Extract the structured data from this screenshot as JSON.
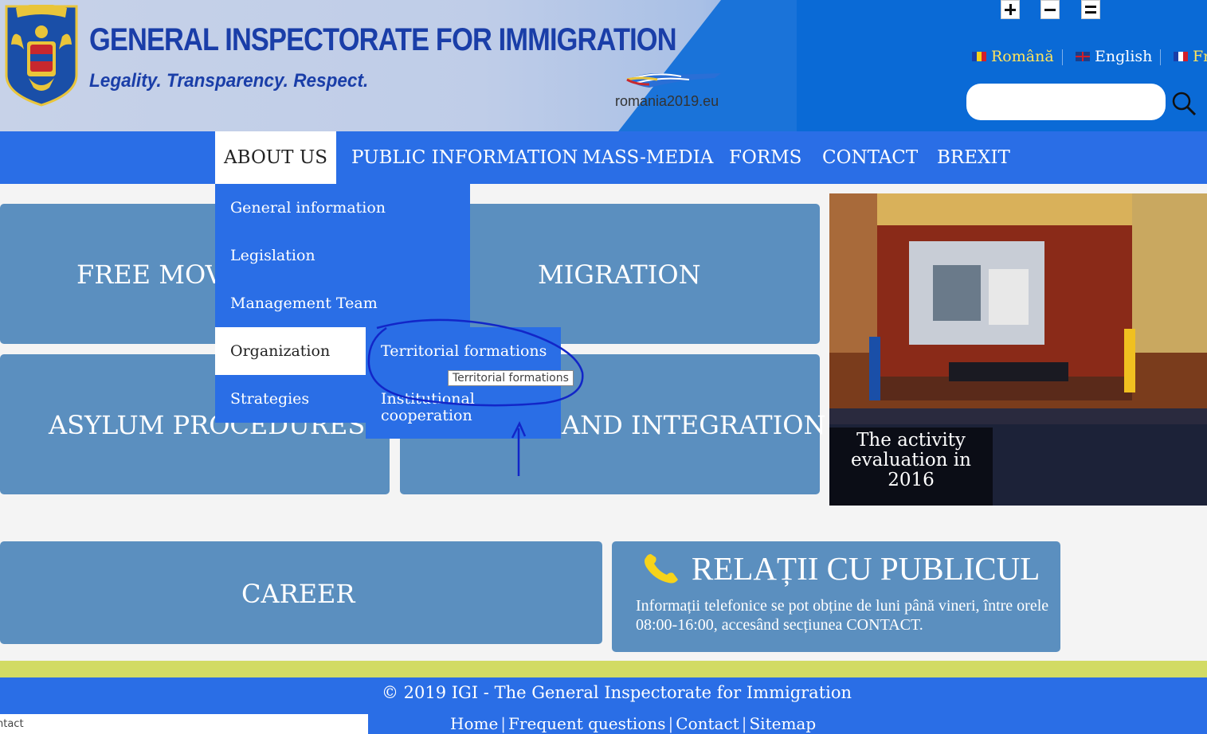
{
  "header": {
    "title": "GENERAL INSPECTORATE FOR IMMIGRATION",
    "tagline": "Legality. Transparency. Respect.",
    "partner_logo_text": "romania2019.eu"
  },
  "accessibility_controls": [
    "zoom-in-icon",
    "zoom-out-icon",
    "menu-icon"
  ],
  "languages": [
    {
      "label": "Română",
      "flag": "ro"
    },
    {
      "label": "English",
      "flag": "uk"
    },
    {
      "label": "Fr",
      "flag": "fr"
    }
  ],
  "search": {
    "placeholder": "",
    "icon": "search-icon"
  },
  "nav": {
    "items": [
      "ABOUT US",
      "PUBLIC INFORMATION",
      "MASS-MEDIA",
      "FORMS",
      "CONTACT",
      "BREXIT"
    ],
    "active": "ABOUT US"
  },
  "dropdown": {
    "items": [
      "General information",
      "Legislation",
      "Management Team",
      "Organization",
      "Strategies"
    ],
    "highlighted": "Organization",
    "submenu": [
      "Territorial formations",
      "Institutional cooperation"
    ],
    "tooltip": "Territorial formations"
  },
  "tiles": {
    "free_movement": "FREE MOVE",
    "migration": "MIGRATION",
    "asylum": "ASYLUM PROCEDURES",
    "integration": "AND INTEGRATION",
    "career": "CAREER"
  },
  "photo": {
    "caption": "The activity evaluation in 2016"
  },
  "relatii": {
    "title": "RELAȚII CU PUBLICUL",
    "text": "Informații telefonice se pot obține de luni până vineri, între orele 08:00-16:00, accesând secțiunea CONTACT.",
    "icon": "phone-icon"
  },
  "footer": {
    "copyright": "© 2019 IGI - The General Inspectorate for Immigration",
    "links": [
      "Home",
      "Frequent questions",
      "Contact",
      "Sitemap"
    ],
    "panel_text": "ntact"
  },
  "colors": {
    "nav_blue": "#2a6ee6",
    "tile_blue": "#5b8fbf",
    "title_blue": "#1a3ea8",
    "green_bar": "#d2db64",
    "annotation_ink": "#1226c8"
  }
}
